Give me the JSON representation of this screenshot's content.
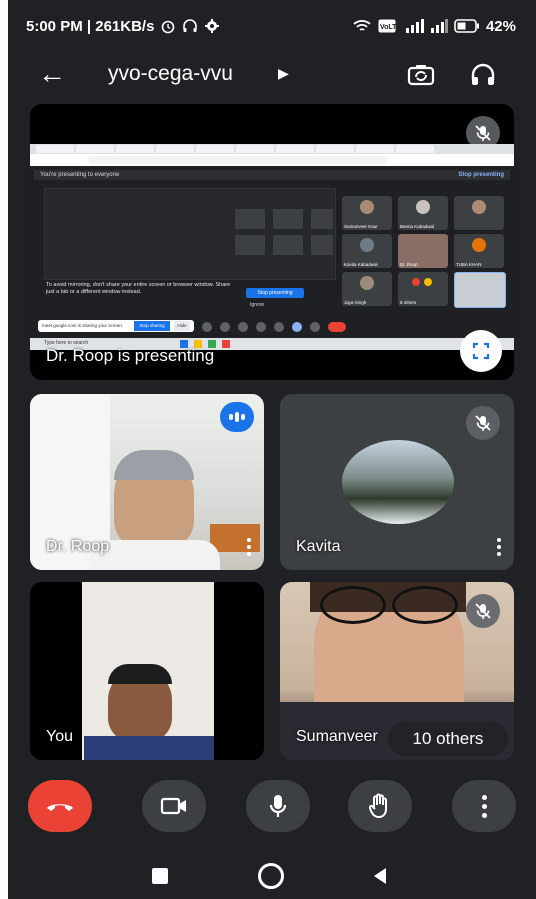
{
  "status_bar": {
    "time_speed": "5:00 PM | 261KB/s",
    "battery": "42%"
  },
  "app_bar": {
    "meeting_code": "yvo-cega-vvu"
  },
  "presentation": {
    "caption": "Dr. Roop is presenting",
    "shared_screen": {
      "banner": "You're presenting to everyone",
      "banner_action": "Stop presenting",
      "warning": "To avoid mirroring, don't share your entire screen or browser window. Share just a tab or a different window instead.",
      "stop_button": "Stop presenting",
      "ignore": "Ignore",
      "notification": "meet.google.com is sharing your screen.",
      "notification_action": "Stop sharing",
      "notification_hide": "Hide",
      "search_placeholder": "Type here to search",
      "tiles": [
        "Sumanveer Kaur",
        "Beena Kabadwal",
        "",
        "Kavita Kabadwal",
        "Dr. Roop",
        "TUBA KHAN",
        "Jaya Singh",
        "8 others",
        ""
      ]
    }
  },
  "participants": [
    {
      "name": "Dr. Roop",
      "speaking": true
    },
    {
      "name": "Kavita",
      "muted": true
    },
    {
      "name": "You"
    },
    {
      "name": "Sumanveer",
      "muted": true
    }
  ],
  "others_chip": "10 others",
  "colors": {
    "background": "#202124",
    "tile": "#3c4043",
    "end_call": "#ea4335",
    "accent": "#1a73e8"
  },
  "icons": [
    "back-arrow-icon",
    "dropdown-arrow-icon",
    "switch-camera-icon",
    "headphones-icon",
    "mic-off-icon",
    "fullscreen-icon",
    "speaking-icon",
    "more-vert-icon",
    "end-call-icon",
    "video-icon",
    "mic-icon",
    "raise-hand-icon",
    "recents-icon",
    "home-icon",
    "back-icon"
  ]
}
